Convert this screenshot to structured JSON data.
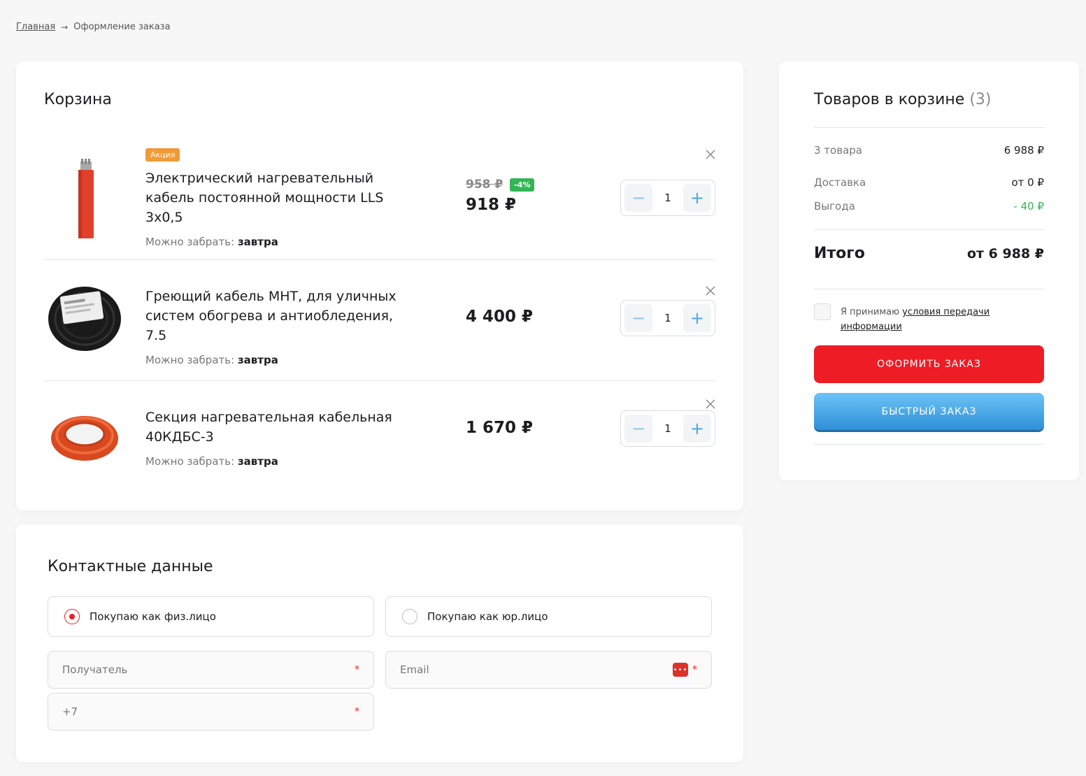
{
  "breadcrumb": {
    "home": "Главная",
    "current": "Оформление заказа"
  },
  "cart": {
    "title": "Корзина",
    "items": [
      {
        "badge": "Акция",
        "name": "Электрический нагревательный кабель постоянной мощности LLS 3x0,5",
        "old_price": "958 ₽",
        "discount": "-4%",
        "price": "918 ₽",
        "pickup_label": "Можно забрать:",
        "pickup_value": "завтра",
        "qty": "1"
      },
      {
        "name": "Греющий кабель MHT, для уличных систем обогрева и антиобледения, 7.5",
        "price": "4 400 ₽",
        "pickup_label": "Можно забрать:",
        "pickup_value": "завтра",
        "qty": "1"
      },
      {
        "name": "Секция нагревательная кабельная 40КДБС-3",
        "price": "1 670 ₽",
        "pickup_label": "Можно забрать:",
        "pickup_value": "завтра",
        "qty": "1"
      }
    ],
    "minus": "−",
    "plus": "+"
  },
  "summary": {
    "title": "Товаров в корзине",
    "count": "(3)",
    "goods_label": "3 товара",
    "goods_value": "6 988 ₽",
    "delivery_label": "Доставка",
    "delivery_value": "от 0 ₽",
    "benefit_label": "Выгода",
    "benefit_value": "- 40 ₽",
    "total_label": "Итого",
    "total_value": "от 6 988 ₽",
    "agree_text": "Я принимаю",
    "agree_link": "условия передачи информации",
    "order_button": "ОФОРМИТЬ ЗАКАЗ",
    "quick_button": "БЫСТРЫЙ ЗАКАЗ"
  },
  "contacts": {
    "title": "Контактные данные",
    "individual": "Покупаю как физ.лицо",
    "legal": "Покупаю как юр.лицо",
    "recipient_placeholder": "Получатель",
    "email_placeholder": "Email",
    "phone_placeholder": "+7",
    "required_mark": "*",
    "pw_icon_text": "•••"
  },
  "colors": {
    "accent_red": "#ee1c25",
    "accent_blue": "#2f8fd8",
    "promo_orange": "#f19a38",
    "discount_green": "#33b555"
  },
  "icons": {
    "close": "close-icon",
    "password": "password-manager-icon"
  }
}
